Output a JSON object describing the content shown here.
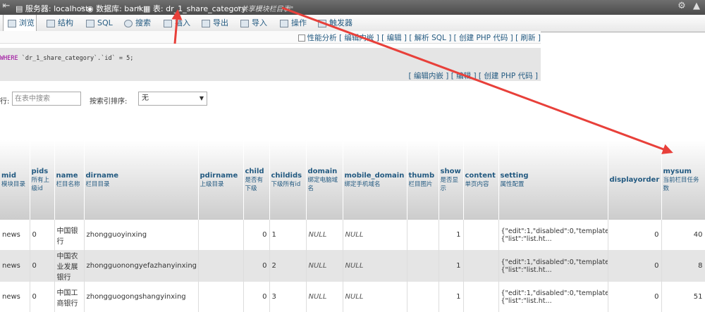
{
  "breadcrumb": {
    "server_label": "服务器: localhost",
    "database_label": "数据库: bank",
    "table_label": "表: dr_1_share_category",
    "table_comment": "\"共享模块栏目表\""
  },
  "tabs": [
    {
      "label": "浏览",
      "icon": "browse-icon"
    },
    {
      "label": "结构",
      "icon": "structure-icon"
    },
    {
      "label": "SQL",
      "icon": "sql-icon"
    },
    {
      "label": "搜索",
      "icon": "search-icon"
    },
    {
      "label": "插入",
      "icon": "insert-icon"
    },
    {
      "label": "导出",
      "icon": "export-icon"
    },
    {
      "label": "导入",
      "icon": "import-icon"
    },
    {
      "label": "操作",
      "icon": "operations-icon"
    },
    {
      "label": "触发器",
      "icon": "triggers-icon"
    }
  ],
  "query_panel": {
    "links": "性能分析 [ 编辑内嵌 ] [ 编辑 ] [ 解析 SQL ] [ 创建 PHP 代码 ] [ 刷新 ]",
    "sql_keyword": "WHERE",
    "sql_rest": " `dr_1_share_category`.`id` = 5;",
    "bottom_links": "[ 编辑内嵌 ] [ 编辑 ] [ 创建 PHP 代码 ]"
  },
  "filter": {
    "label": "行:",
    "placeholder": "在表中搜索",
    "sort_label": "按索引排序:",
    "sort_value": "无"
  },
  "columns": [
    {
      "name": "mid",
      "comment": "模块目录"
    },
    {
      "name": "pids",
      "comment": "所有上级id"
    },
    {
      "name": "name",
      "comment": "栏目名称"
    },
    {
      "name": "dirname",
      "comment": "栏目目录"
    },
    {
      "name": "pdirname",
      "comment": "上级目录"
    },
    {
      "name": "child",
      "comment": "是否有下级"
    },
    {
      "name": "childids",
      "comment": "下级所有id"
    },
    {
      "name": "domain",
      "comment": "绑定电脑域名"
    },
    {
      "name": "mobile_domain",
      "comment": "绑定手机域名"
    },
    {
      "name": "thumb",
      "comment": "栏目图片"
    },
    {
      "name": "show",
      "comment": "是否显示"
    },
    {
      "name": "content",
      "comment": "单页内容"
    },
    {
      "name": "setting",
      "comment": "属性配置"
    },
    {
      "name": "displayorder",
      "comment": ""
    },
    {
      "name": "mysum",
      "comment": "当前栏目任务数"
    }
  ],
  "rows": [
    {
      "mid": "news",
      "pids": "0",
      "name": "中国银行",
      "dirname": "zhongguoyinxing",
      "pdirname": "",
      "child": "0",
      "childids": "1",
      "domain": "NULL",
      "mobile_domain": "NULL",
      "thumb": "",
      "show": "1",
      "content": "",
      "setting": "{\"edit\":1,\"disabled\":0,\"template\":{\"list\":\"list.ht...",
      "displayorder": "0",
      "mysum": "40"
    },
    {
      "mid": "news",
      "pids": "0",
      "name": "中国农业发展银行",
      "dirname": "zhongguonongyefazhanyinxing",
      "pdirname": "",
      "child": "0",
      "childids": "2",
      "domain": "NULL",
      "mobile_domain": "NULL",
      "thumb": "",
      "show": "1",
      "content": "",
      "setting": "{\"edit\":1,\"disabled\":0,\"template\":{\"list\":\"list.ht...",
      "displayorder": "0",
      "mysum": "8"
    },
    {
      "mid": "news",
      "pids": "0",
      "name": "中国工商银行",
      "dirname": "zhongguogongshangyinxing",
      "pdirname": "",
      "child": "0",
      "childids": "3",
      "domain": "NULL",
      "mobile_domain": "NULL",
      "thumb": "",
      "show": "1",
      "content": "",
      "setting": "{\"edit\":1,\"disabled\":0,\"template\":{\"list\":\"list.ht...",
      "displayorder": "0",
      "mysum": "51"
    }
  ],
  "annotation_color": "#e8403a"
}
